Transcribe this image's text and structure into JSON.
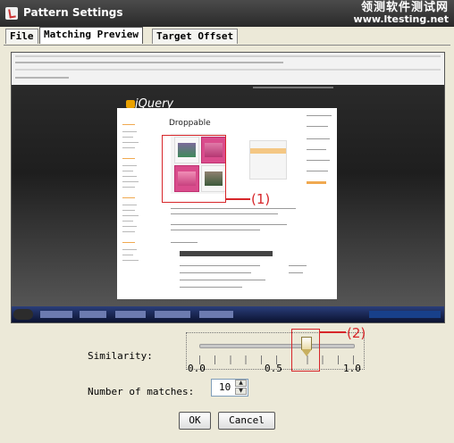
{
  "window": {
    "title": "Pattern Settings",
    "watermark_line1": "领测软件测试网",
    "watermark_line2": "www.ltesting.net"
  },
  "tabs": [
    {
      "label": "File",
      "active": false
    },
    {
      "label": "Matching Preview",
      "active": true
    },
    {
      "label": "Target Offset",
      "active": false
    }
  ],
  "preview": {
    "page_title": "Droppable",
    "logo_text": "jQuery",
    "annotation_1": "(1)"
  },
  "similarity": {
    "label": "Similarity:",
    "value": 0.7,
    "min": 0,
    "max": 1,
    "tick_labels": [
      "0.0",
      "0.5",
      "1.0"
    ],
    "annotation_2": "(2)"
  },
  "matches": {
    "label": "Number of matches:",
    "value": "10"
  },
  "buttons": {
    "ok": "OK",
    "cancel": "Cancel"
  },
  "colors": {
    "annotation_red": "#d7262a",
    "title_bar": "#333333",
    "dialog_bg": "#ece9d8"
  }
}
